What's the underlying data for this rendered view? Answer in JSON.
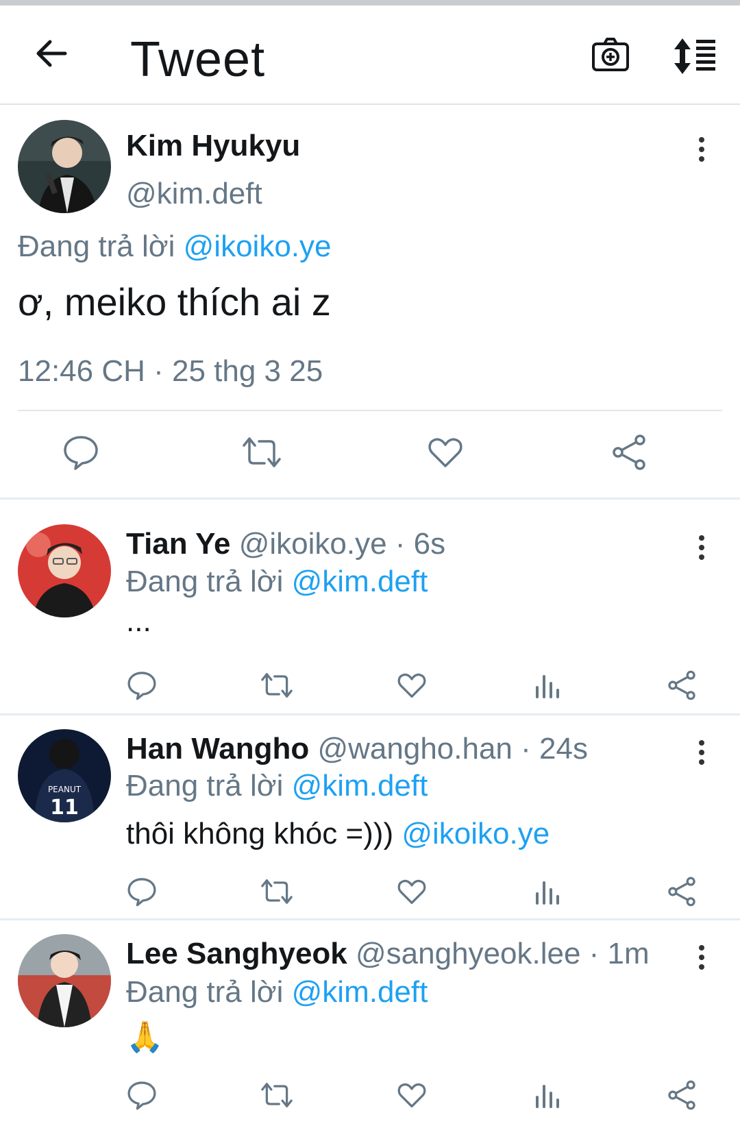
{
  "header": {
    "title": "Tweet",
    "back_icon": "arrow-left-icon",
    "camera_icon": "camera-plus-icon",
    "sort_icon": "sort-list-icon"
  },
  "main_tweet": {
    "display_name": "Kim Hyukyu",
    "handle": "@kim.deft",
    "replying_prefix": "Đang trả lời",
    "replying_to": "@ikoiko.ye",
    "text": "ơ, meiko thích ai z",
    "timestamp": "12:46 CH · 25 thg 3 25"
  },
  "replies": [
    {
      "display_name": "Tian Ye",
      "handle": "@ikoiko.ye",
      "time": " · 6s",
      "replying_prefix": "Đang trả lời",
      "replying_to": "@kim.deft",
      "text": "...",
      "mention": ""
    },
    {
      "display_name": "Han Wangho",
      "handle": "@wangho.han",
      "time": " · 24s",
      "replying_prefix": "Đang trả lời",
      "replying_to": "@kim.deft",
      "text": "thôi không khóc =)))",
      "mention": "@ikoiko.ye"
    },
    {
      "display_name": "Lee Sanghyeok",
      "handle": "@sanghyeok.lee",
      "time": " · 1m",
      "replying_prefix": "Đang trả lời",
      "replying_to": "@kim.deft",
      "text": "🙏",
      "mention": ""
    }
  ],
  "colors": {
    "link": "#1da1f2",
    "muted": "#657786",
    "text": "#14171a",
    "icon": "#657786",
    "divider": "#e6ecf0"
  }
}
